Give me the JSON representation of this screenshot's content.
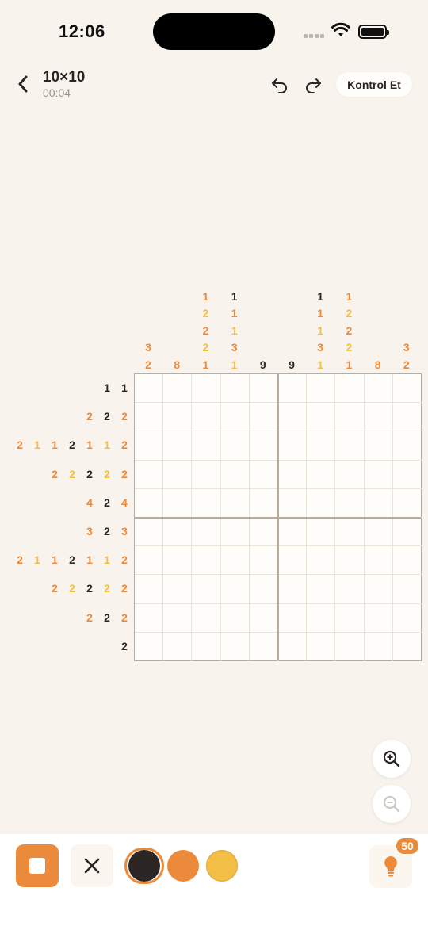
{
  "status_bar": {
    "time": "12:06"
  },
  "header": {
    "title": "10×10",
    "timer": "00:04",
    "check_label": "Kontrol Et"
  },
  "colors": {
    "dark": "#2b2624",
    "orange": "#ec8a3c",
    "yellow": "#f3be45",
    "background": "#f8f3ec"
  },
  "puzzle": {
    "size": 10,
    "column_clues": [
      [
        {
          "v": "3",
          "c": "orange"
        },
        {
          "v": "2",
          "c": "orange"
        }
      ],
      [
        {
          "v": "8",
          "c": "orange"
        }
      ],
      [
        {
          "v": "1",
          "c": "orange"
        },
        {
          "v": "2",
          "c": "yellow"
        },
        {
          "v": "2",
          "c": "orange"
        },
        {
          "v": "2",
          "c": "yellow"
        },
        {
          "v": "1",
          "c": "orange"
        }
      ],
      [
        {
          "v": "1",
          "c": "dark"
        },
        {
          "v": "1",
          "c": "orange"
        },
        {
          "v": "1",
          "c": "yellow"
        },
        {
          "v": "3",
          "c": "orange"
        },
        {
          "v": "1",
          "c": "yellow"
        }
      ],
      [
        {
          "v": "9",
          "c": "dark"
        }
      ],
      [
        {
          "v": "9",
          "c": "dark"
        }
      ],
      [
        {
          "v": "1",
          "c": "dark"
        },
        {
          "v": "1",
          "c": "orange"
        },
        {
          "v": "1",
          "c": "yellow"
        },
        {
          "v": "3",
          "c": "orange"
        },
        {
          "v": "1",
          "c": "yellow"
        }
      ],
      [
        {
          "v": "1",
          "c": "orange"
        },
        {
          "v": "2",
          "c": "yellow"
        },
        {
          "v": "2",
          "c": "orange"
        },
        {
          "v": "2",
          "c": "yellow"
        },
        {
          "v": "1",
          "c": "orange"
        }
      ],
      [
        {
          "v": "8",
          "c": "orange"
        }
      ],
      [
        {
          "v": "3",
          "c": "orange"
        },
        {
          "v": "2",
          "c": "orange"
        }
      ]
    ],
    "row_clues": [
      [
        {
          "v": "1",
          "c": "dark"
        },
        {
          "v": "1",
          "c": "dark"
        }
      ],
      [
        {
          "v": "2",
          "c": "orange"
        },
        {
          "v": "2",
          "c": "dark"
        },
        {
          "v": "2",
          "c": "orange"
        }
      ],
      [
        {
          "v": "2",
          "c": "orange"
        },
        {
          "v": "1",
          "c": "yellow"
        },
        {
          "v": "1",
          "c": "orange"
        },
        {
          "v": "2",
          "c": "dark"
        },
        {
          "v": "1",
          "c": "orange"
        },
        {
          "v": "1",
          "c": "yellow"
        },
        {
          "v": "2",
          "c": "orange"
        }
      ],
      [
        {
          "v": "2",
          "c": "orange"
        },
        {
          "v": "2",
          "c": "yellow"
        },
        {
          "v": "2",
          "c": "dark"
        },
        {
          "v": "2",
          "c": "yellow"
        },
        {
          "v": "2",
          "c": "orange"
        }
      ],
      [
        {
          "v": "4",
          "c": "orange"
        },
        {
          "v": "2",
          "c": "dark"
        },
        {
          "v": "4",
          "c": "orange"
        }
      ],
      [
        {
          "v": "3",
          "c": "orange"
        },
        {
          "v": "2",
          "c": "dark"
        },
        {
          "v": "3",
          "c": "orange"
        }
      ],
      [
        {
          "v": "2",
          "c": "orange"
        },
        {
          "v": "1",
          "c": "yellow"
        },
        {
          "v": "1",
          "c": "orange"
        },
        {
          "v": "2",
          "c": "dark"
        },
        {
          "v": "1",
          "c": "orange"
        },
        {
          "v": "1",
          "c": "yellow"
        },
        {
          "v": "2",
          "c": "orange"
        }
      ],
      [
        {
          "v": "2",
          "c": "orange"
        },
        {
          "v": "2",
          "c": "yellow"
        },
        {
          "v": "2",
          "c": "dark"
        },
        {
          "v": "2",
          "c": "yellow"
        },
        {
          "v": "2",
          "c": "orange"
        }
      ],
      [
        {
          "v": "2",
          "c": "orange"
        },
        {
          "v": "2",
          "c": "dark"
        },
        {
          "v": "2",
          "c": "orange"
        }
      ],
      [
        {
          "v": "2",
          "c": "dark"
        }
      ]
    ]
  },
  "toolbar": {
    "tools": [
      "fill-tool",
      "cross-tool"
    ],
    "swatches": [
      "dark",
      "orange",
      "yellow"
    ],
    "selected_swatch": "dark",
    "hint_count": "50"
  }
}
